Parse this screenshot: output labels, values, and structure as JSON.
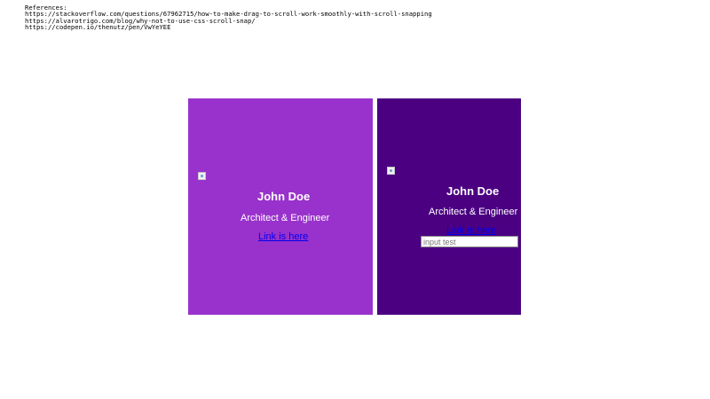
{
  "references": {
    "heading": "References:",
    "urls": [
      "https://stackoverflow.com/questions/67962715/how-to-make-drag-to-scroll-work-smoothly-with-scroll-snapping",
      "https://alvarotrigo.com/blog/why-not-to-use-css-scroll-snap/",
      "https://codepen.io/thenutz/pen/VwYeYEE"
    ]
  },
  "cards": [
    {
      "name": "John Doe",
      "role": "Architect & Engineer",
      "link_text": "Link is here",
      "background": "#9932cc"
    },
    {
      "name": "John Doe",
      "role": "Architect & Engineer",
      "link_text": "Link is here",
      "background": "#4b0082",
      "input_placeholder": "input test"
    }
  ]
}
